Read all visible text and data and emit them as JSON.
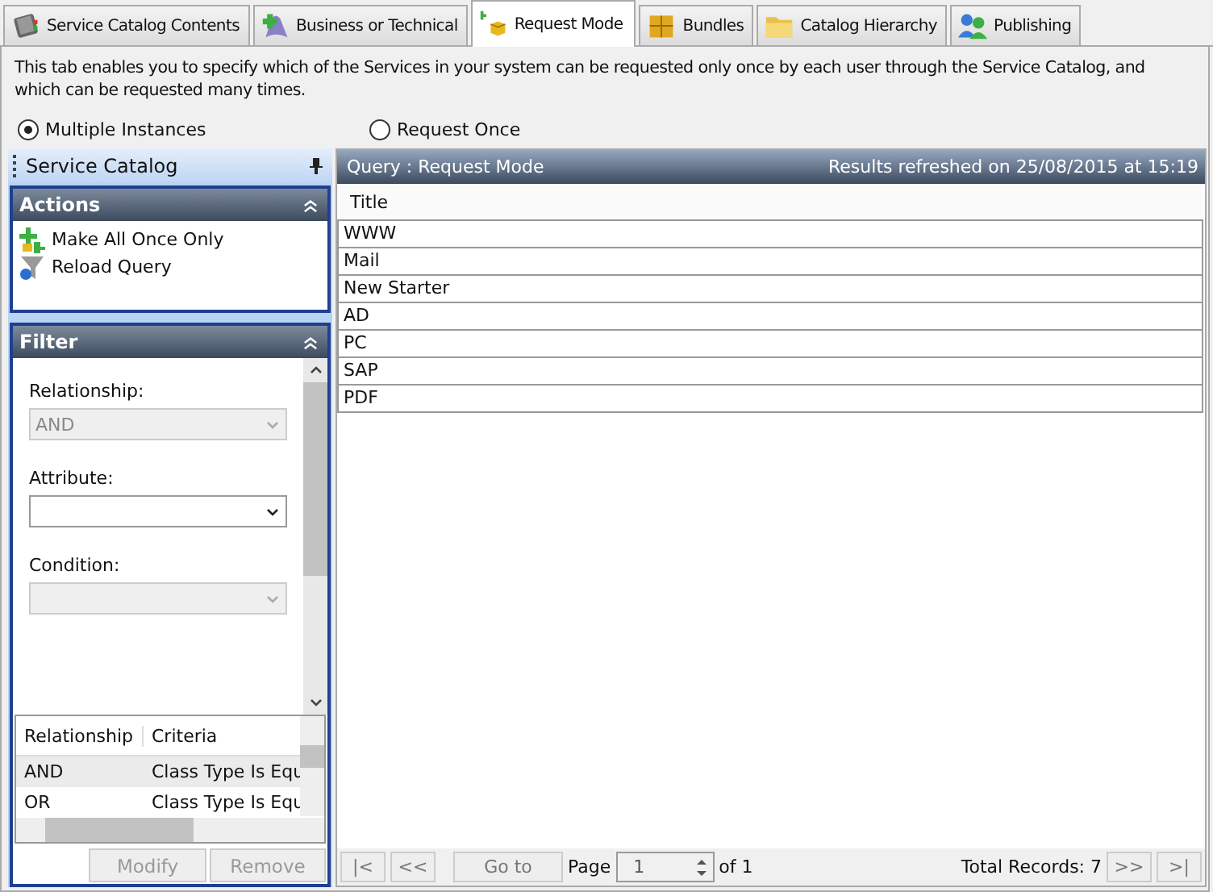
{
  "tabs": [
    {
      "label": "Service Catalog Contents",
      "selected": false
    },
    {
      "label": "Business or Technical",
      "selected": false
    },
    {
      "label": "Request Mode",
      "selected": true
    },
    {
      "label": "Bundles",
      "selected": false
    },
    {
      "label": "Catalog Hierarchy",
      "selected": false
    },
    {
      "label": "Publishing",
      "selected": false
    }
  ],
  "description": "This tab enables you to specify which of the Services in your system can be requested only once by each user through the Service Catalog, and which can be requested many times.",
  "modes": [
    {
      "label": "Multiple Instances",
      "selected": true
    },
    {
      "label": "Request Once",
      "selected": false
    }
  ],
  "sidebar": {
    "title": "Service Catalog",
    "actions": {
      "title": "Actions",
      "items": [
        {
          "label": "Make All Once Only"
        },
        {
          "label": "Reload Query"
        }
      ]
    },
    "filter": {
      "title": "Filter",
      "fields": [
        {
          "label": "Relationship:",
          "value": "AND",
          "disabled": true
        },
        {
          "label": "Attribute:",
          "disabled": false
        },
        {
          "label": "Condition:",
          "disabled": true
        }
      ],
      "criteria_columns": [
        "Relationship",
        "Criteria"
      ],
      "criteria_rows": [
        {
          "relationship": "AND",
          "criteria": "Class Type Is Equ",
          "selected": true
        },
        {
          "relationship": "OR",
          "criteria": "Class Type Is Equ",
          "selected": false
        }
      ],
      "buttons": [
        {
          "label": "Modify",
          "disabled": true
        },
        {
          "label": "Remove",
          "disabled": true
        }
      ]
    }
  },
  "query": {
    "title": "Query : Request Mode",
    "refreshed": "Results refreshed on 25/08/2015 at 15:19",
    "columns": [
      "Title"
    ],
    "rows": [
      "WWW",
      "Mail",
      "New Starter",
      "AD",
      "PC",
      "SAP",
      "PDF"
    ]
  },
  "pager": {
    "first": "|<",
    "previous": "<<",
    "goto": "Go to",
    "page_label": "Page",
    "page_value": "1",
    "of": "of 1",
    "total": "Total Records: 7",
    "next": ">>",
    "last": ">|"
  }
}
